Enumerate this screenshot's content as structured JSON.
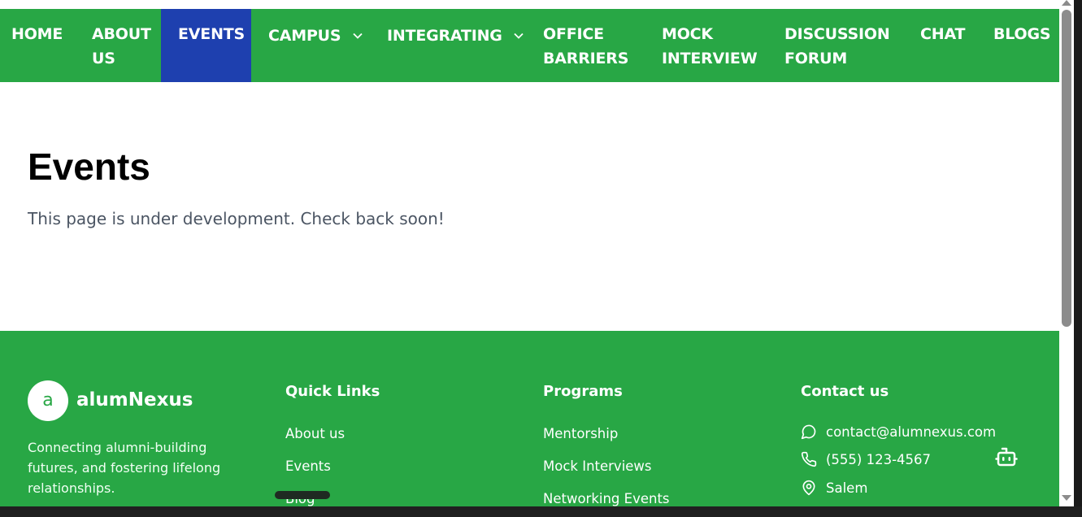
{
  "nav": {
    "items": [
      {
        "label": "HOME"
      },
      {
        "label": "ABOUT\nUS"
      },
      {
        "label": "EVENTS"
      },
      {
        "label": "CAMPUS"
      },
      {
        "label": "INTEGRATING"
      },
      {
        "label": "OFFICE\nBARRIERS"
      },
      {
        "label": "MOCK\nINTERVIEW"
      },
      {
        "label": "DISCUSSION\nFORUM"
      },
      {
        "label": "CHAT"
      },
      {
        "label": "BLOGS"
      }
    ],
    "active": "EVENTS",
    "dropdown_icon": "chevron-down-icon"
  },
  "main": {
    "title": "Events",
    "subtitle": "This page is under development. Check back soon!"
  },
  "footer": {
    "logo_letter": "a",
    "brand": "alumNexus",
    "tagline": "Connecting alumni-building futures, and fostering lifelong relationships.",
    "quick_links": {
      "title": "Quick Links",
      "items": [
        "About us",
        "Events",
        "Blog"
      ]
    },
    "programs": {
      "title": "Programs",
      "items": [
        "Mentorship",
        "Mock Interviews",
        "Networking Events"
      ]
    },
    "contact": {
      "title": "Contact us",
      "email": "contact@alumnexus.com",
      "phone": "(555) 123-4567",
      "location": "Salem"
    },
    "chatbot_icon": "robot-icon"
  },
  "colors": {
    "primary_green": "#28a745",
    "active_blue": "#1e40af",
    "text_gray": "#4b5563"
  }
}
